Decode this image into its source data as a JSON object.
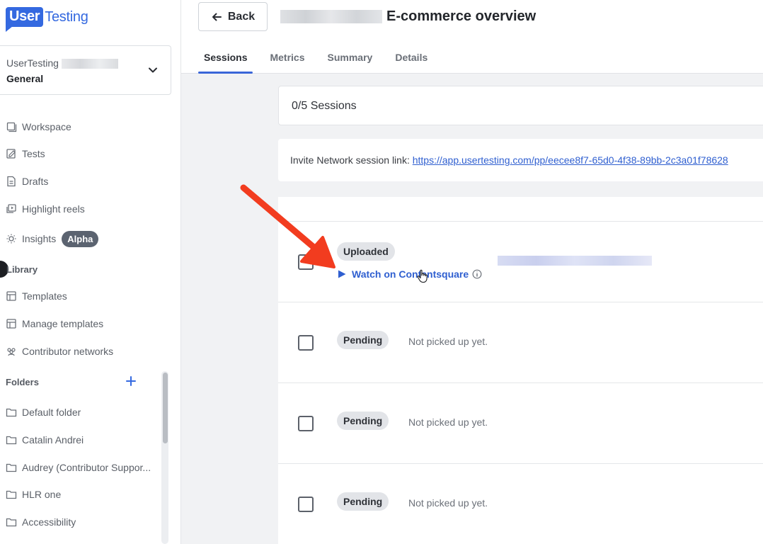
{
  "brand": {
    "logo_box": "User",
    "logo_text": "Testing"
  },
  "workspace": {
    "org": "UserTesting",
    "name": "General"
  },
  "nav": {
    "workspace": "Workspace",
    "tests": "Tests",
    "drafts": "Drafts",
    "highlight_reels": "Highlight reels",
    "insights": "Insights",
    "insights_badge": "Alpha",
    "library_label": "Library",
    "templates": "Templates",
    "manage_templates": "Manage templates",
    "contributor_networks": "Contributor networks",
    "folders_label": "Folders",
    "folders": [
      "Default folder",
      "Catalin Andrei",
      "Audrey (Contributor Suppor...",
      "HLR one",
      "Accessibility"
    ]
  },
  "header": {
    "back_label": "Back",
    "title": "E-commerce overview",
    "tabs": [
      "Sessions",
      "Metrics",
      "Summary",
      "Details"
    ]
  },
  "main": {
    "sessions_count": "0/5 Sessions",
    "invite_label": "Invite Network session link: ",
    "invite_url": "https://app.usertesting.com/pp/eecee8f7-65d0-4f38-89bb-2c3a01f78628",
    "rows": [
      {
        "status": "Uploaded",
        "link": "Watch on Contentsquare"
      },
      {
        "status": "Pending",
        "note": "Not picked up yet."
      },
      {
        "status": "Pending",
        "note": "Not picked up yet."
      },
      {
        "status": "Pending",
        "note": "Not picked up yet."
      }
    ]
  },
  "colors": {
    "brand": "#3469e0",
    "accent": "#3a66d8",
    "link": "#2f5fd0",
    "arrow": "#f23c1f"
  }
}
